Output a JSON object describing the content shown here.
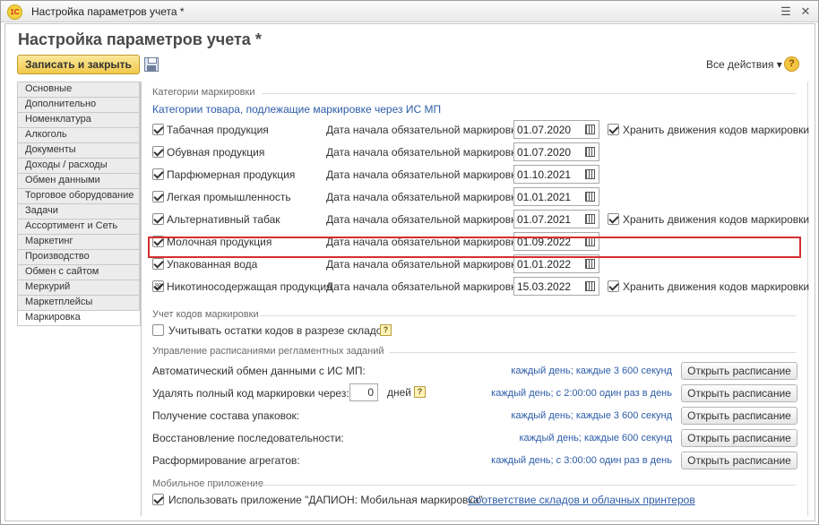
{
  "window": {
    "logo": "1С",
    "title": "Настройка параметров учета *"
  },
  "page": {
    "title": "Настройка параметров учета *"
  },
  "toolbar": {
    "save_close": "Записать и закрыть",
    "all_actions": "Все действия ▾",
    "help": "?"
  },
  "nav": [
    {
      "label": "Основные"
    },
    {
      "label": "Дополнительно"
    },
    {
      "label": "Номенклатура"
    },
    {
      "label": "Алкоголь"
    },
    {
      "label": "Документы"
    },
    {
      "label": "Доходы / расходы"
    },
    {
      "label": "Обмен данными"
    },
    {
      "label": "Торговое оборудование"
    },
    {
      "label": "Задачи"
    },
    {
      "label": "Ассортимент и Сеть"
    },
    {
      "label": "Маркетинг"
    },
    {
      "label": "Производство"
    },
    {
      "label": "Обмен с сайтом"
    },
    {
      "label": "Меркурий"
    },
    {
      "label": "Маркетплейсы"
    },
    {
      "label": "Маркировка",
      "active": true
    }
  ],
  "categories": {
    "section_title": "Категории маркировки",
    "subtitle": "Категории товара, подлежащие маркировке через ИС МП",
    "date_label": "Дата начала обязательной маркировки:",
    "keep_label": "Хранить движения кодов маркировки",
    "rows": [
      {
        "name": "Табачная продукция",
        "checked": true,
        "date": "01.07.2020",
        "keep": true
      },
      {
        "name": "Обувная продукция",
        "checked": true,
        "date": "01.07.2020",
        "keep": false
      },
      {
        "name": "Парфюмерная продукция",
        "checked": true,
        "date": "01.10.2021",
        "keep": false
      },
      {
        "name": "Легкая промышленность",
        "checked": true,
        "date": "01.01.2021",
        "keep": false
      },
      {
        "name": "Альтернативный табак",
        "checked": true,
        "date": "01.07.2021",
        "keep": true
      },
      {
        "name": "Молочная продукция",
        "checked": true,
        "date": "01.09.2022",
        "keep": false
      },
      {
        "name": "Упакованная вода",
        "checked": true,
        "date": "01.01.2022",
        "keep": false
      },
      {
        "name": "Никотиносодержащая продукция",
        "checked": true,
        "date": "15.03.2022",
        "keep": true
      }
    ]
  },
  "codes": {
    "section_title": "Учет кодов маркировки",
    "stock_label": "Учитывать остатки кодов в разрезе складов",
    "help": "?"
  },
  "schedules": {
    "section_title": "Управление расписаниями регламентных заданий",
    "button_label": "Открыть расписание",
    "days_unit": "дней",
    "days_value": "0",
    "rows": [
      {
        "label": "Автоматический обмен данными с ИС МП:",
        "schedule": "каждый день; каждые 3 600 секунд"
      },
      {
        "label": "Удалять полный код маркировки через:",
        "schedule": "каждый день; с 2:00:00 один раз в день"
      },
      {
        "label": "Получение состава упаковок:",
        "schedule": "каждый день; каждые 3 600 секунд"
      },
      {
        "label": "Восстановление последовательности:",
        "schedule": "каждый день; каждые 600 секунд"
      },
      {
        "label": "Расформирование агрегатов:",
        "schedule": "каждый день; с 3:00:00 один раз в день"
      }
    ]
  },
  "mobile": {
    "section_title": "Мобильное приложение",
    "use_label": "Использовать приложение \"ДАПИОН: Мобильная маркировка\"",
    "link": "Соответствие складов и облачных принтеров"
  }
}
